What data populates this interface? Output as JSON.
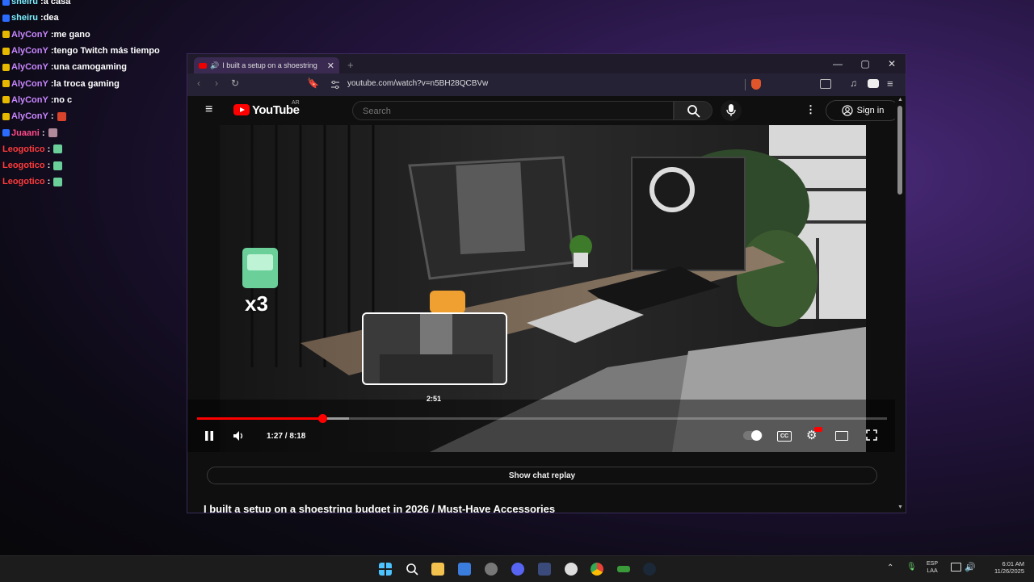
{
  "chat": {
    "messages": [
      {
        "user": "sheiru",
        "text": "a casa",
        "color": "#7cf0ff",
        "badge": "#2b6cff"
      },
      {
        "user": "sheiru",
        "text": "dea",
        "color": "#7cf0ff",
        "badge": "#2b6cff"
      },
      {
        "user": "AlyConY",
        "text": "me gano",
        "color": "#c987ff",
        "badge": "#e6b800"
      },
      {
        "user": "AlyConY",
        "text": "tengo Twitch más tiempo",
        "color": "#c987ff",
        "badge": "#e6b800"
      },
      {
        "user": "AlyConY",
        "text": "una camogaming",
        "color": "#c987ff",
        "badge": "#e6b800"
      },
      {
        "user": "AlyConY",
        "text": "la troca gaming",
        "color": "#c987ff",
        "badge": "#e6b800"
      },
      {
        "user": "AlyConY",
        "text": "no c",
        "color": "#c987ff",
        "badge": "#e6b800"
      },
      {
        "user": "AlyConY",
        "text": "",
        "color": "#c987ff",
        "badge": "#e6b800",
        "emote": "#d8442b"
      },
      {
        "user": "Juaani",
        "text": "",
        "color": "#ff4a8a",
        "badge": "#2b6cff",
        "emote": "#b08a9a"
      },
      {
        "user": "Leogotico",
        "text": "",
        "color": "#ff3b3b",
        "badge": null,
        "emote": "#6bcf9a"
      },
      {
        "user": "Leogotico",
        "text": "",
        "color": "#ff3b3b",
        "badge": null,
        "emote": "#6bcf9a"
      },
      {
        "user": "Leogotico",
        "text": "",
        "color": "#ff3b3b",
        "badge": null,
        "emote": "#6bcf9a"
      }
    ]
  },
  "browser": {
    "tab_title": "I built a setup on a shoestring",
    "tab_close": "✕",
    "new_tab": "+",
    "url": "youtube.com/watch?v=n5BH28QCBVw",
    "win_minimize": "—",
    "win_maximize": "▢",
    "win_close": "✕"
  },
  "youtube": {
    "wordmark": "YouTube",
    "region": "AR",
    "search_placeholder": "Search",
    "sign_in": "Sign in",
    "preview_time": "2:51",
    "time_display": "1:27 / 8:18",
    "progress_fraction": 0.182,
    "buffer_fraction": 0.22,
    "preview_fraction": 0.35,
    "overlay_emote_label": "x3",
    "show_chat_replay": "Show chat replay",
    "video_title": "I built a setup on a shoestring budget in 2026 / Must-Have Accessories"
  },
  "taskbar": {
    "lang_line1": "ESP",
    "lang_line2": "LAA",
    "time": "6:01 AM",
    "date": "11/26/2025"
  },
  "colors": {
    "accent": "#ff0000",
    "chat_bg": "transparent"
  }
}
